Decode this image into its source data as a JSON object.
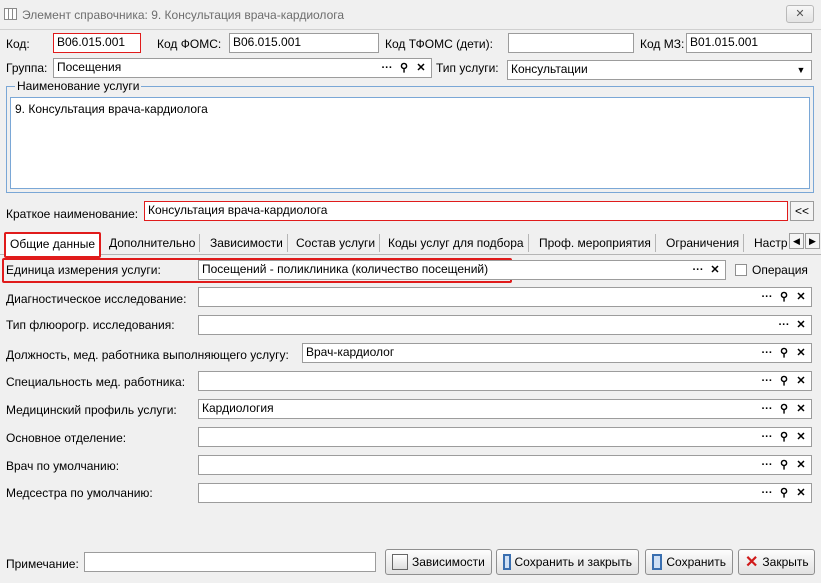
{
  "window": {
    "title": "Элемент справочника: 9. Консультация врача-кардиолога",
    "close_glyph": "✕"
  },
  "codes": {
    "kod_label": "Код:",
    "kod_value": "В06.015.001",
    "foms_label": "Код ФОМС:",
    "foms_value": "В06.015.001",
    "tfoms_label": "Код ТФОМС (дети):",
    "tfoms_value": "",
    "mz_label": "Код МЗ:",
    "mz_value": "В01.015.001"
  },
  "group": {
    "label": "Группа:",
    "value": "Посещения"
  },
  "service_type": {
    "label": "Тип услуги:",
    "value": "Консультации"
  },
  "service_name": {
    "legend": "Наименование услуги",
    "value": "9. Консультация врача-кардиолога"
  },
  "short_name": {
    "label": "Краткое наименование:",
    "value": "Консультация врача-кардиолога",
    "copy_button": "<<"
  },
  "tabs": [
    {
      "label": "Общие данные"
    },
    {
      "label": "Дополнительно"
    },
    {
      "label": "Зависимости"
    },
    {
      "label": "Состав услуги"
    },
    {
      "label": "Коды услуг для подбора"
    },
    {
      "label": "Проф. мероприятия"
    },
    {
      "label": "Ограничения"
    },
    {
      "label": "Настр"
    }
  ],
  "general": {
    "unit_label": "Единица измерения услуги:",
    "unit_value": "Посещений - поликлиника (количество посещений)",
    "operation_label": "Операция",
    "fields": [
      {
        "label": "Диагностическое исследование:",
        "value": ""
      },
      {
        "label": "Тип флюорогр. исследования:",
        "value": ""
      },
      {
        "label": "Должность, мед. работника выполняющего услугу:",
        "value": "Врач-кардиолог"
      },
      {
        "label": "Специальность мед. работника:",
        "value": ""
      },
      {
        "label": "Медицинский профиль услуги:",
        "value": "Кардиология"
      },
      {
        "label": "Основное отделение:",
        "value": ""
      },
      {
        "label": "Врач по умолчанию:",
        "value": ""
      },
      {
        "label": "Медсестра по умолчанию:",
        "value": ""
      }
    ]
  },
  "footer": {
    "note_label": "Примечание:",
    "note_value": "",
    "deps_button": "Зависимости",
    "save_close_button": "Сохранить и закрыть",
    "save_button": "Сохранить",
    "close_button": "Закрыть"
  },
  "icons": {
    "dots": "···",
    "search": "⚲",
    "clear": "✕",
    "dropdown": "▼",
    "tab_prev": "◀",
    "tab_next": "▶"
  },
  "colors": {
    "highlight": "#e01b1b",
    "field_border": "#9c9c9c",
    "fieldset_border": "#7aa7d6",
    "background": "#f0f0f0"
  }
}
